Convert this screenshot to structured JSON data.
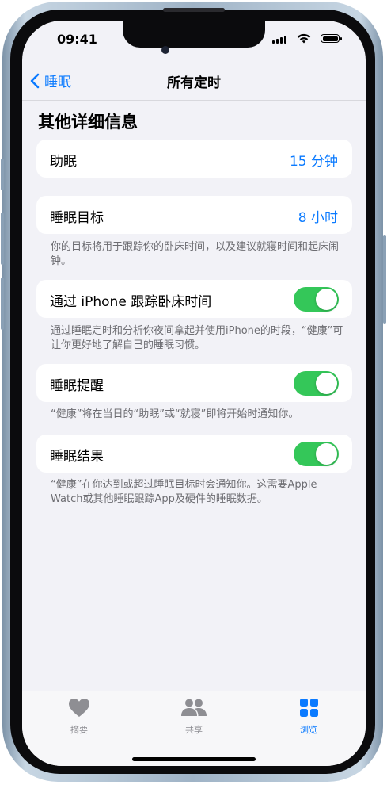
{
  "status_bar": {
    "time": "09:41"
  },
  "nav": {
    "back_label": "睡眠",
    "title": "所有定时"
  },
  "section_title": "其他详细信息",
  "rows": {
    "wind_down": {
      "label": "助眠",
      "value": "15 分钟"
    },
    "sleep_goal": {
      "label": "睡眠目标",
      "value": "8 小时",
      "footnote": "你的目标将用于跟踪你的卧床时间，以及建议就寝时间和起床闹钟。"
    },
    "track_iphone": {
      "label": "通过 iPhone 跟踪卧床时间",
      "toggle_on": true,
      "footnote": "通过睡眠定时和分析你夜间拿起并使用iPhone的时段，“健康”可让你更好地了解自己的睡眠习惯。"
    },
    "sleep_reminder": {
      "label": "睡眠提醒",
      "toggle_on": true,
      "footnote": "“健康”将在当日的“助眠”或“就寝”即将开始时通知你。"
    },
    "sleep_results": {
      "label": "睡眠结果",
      "toggle_on": true,
      "footnote": "“健康”在你达到或超过睡眠目标时会通知你。这需要Apple Watch或其他睡眠跟踪App及硬件的睡眠数据。"
    }
  },
  "tabbar": {
    "summary": {
      "label": "摘要",
      "icon": "heart-icon"
    },
    "sharing": {
      "label": "共享",
      "icon": "people-icon"
    },
    "browse": {
      "label": "浏览",
      "icon": "grid-icon",
      "active": true
    }
  },
  "colors": {
    "accent": "#0a7aff",
    "toggle_on": "#34c759",
    "background": "#f2f2f7"
  }
}
